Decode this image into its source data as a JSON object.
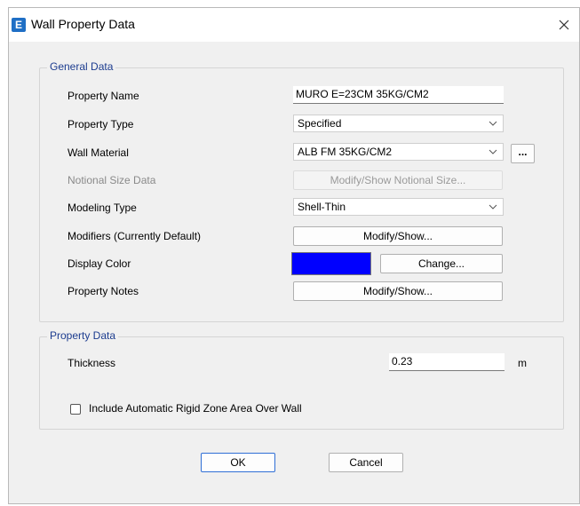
{
  "window": {
    "title": "Wall Property Data",
    "app_icon_letter": "E",
    "close_glyph": "✕"
  },
  "general": {
    "legend": "General Data",
    "property_name_label": "Property Name",
    "property_name_value": "MURO E=23CM 35KG/CM2",
    "property_type_label": "Property Type",
    "property_type_value": "Specified",
    "wall_material_label": "Wall Material",
    "wall_material_value": "ALB FM 35KG/CM2",
    "material_browse_label": "...",
    "notional_label": "Notional Size Data",
    "notional_button": "Modify/Show Notional Size...",
    "modeling_type_label": "Modeling Type",
    "modeling_type_value": "Shell-Thin",
    "modifiers_label": "Modifiers (Currently Default)",
    "modifiers_button": "Modify/Show...",
    "display_color_label": "Display Color",
    "display_color_value": "#0000ff",
    "change_button": "Change...",
    "notes_label": "Property Notes",
    "notes_button": "Modify/Show..."
  },
  "property": {
    "legend": "Property Data",
    "thickness_label": "Thickness",
    "thickness_value": "0.23",
    "thickness_unit": "m",
    "rigid_zone_label": "Include Automatic Rigid Zone Area Over Wall",
    "rigid_zone_checked": false
  },
  "footer": {
    "ok_label": "OK",
    "cancel_label": "Cancel"
  },
  "colors": {
    "accent": "#1f6fc5",
    "legend_text": "#1c3c8f"
  }
}
